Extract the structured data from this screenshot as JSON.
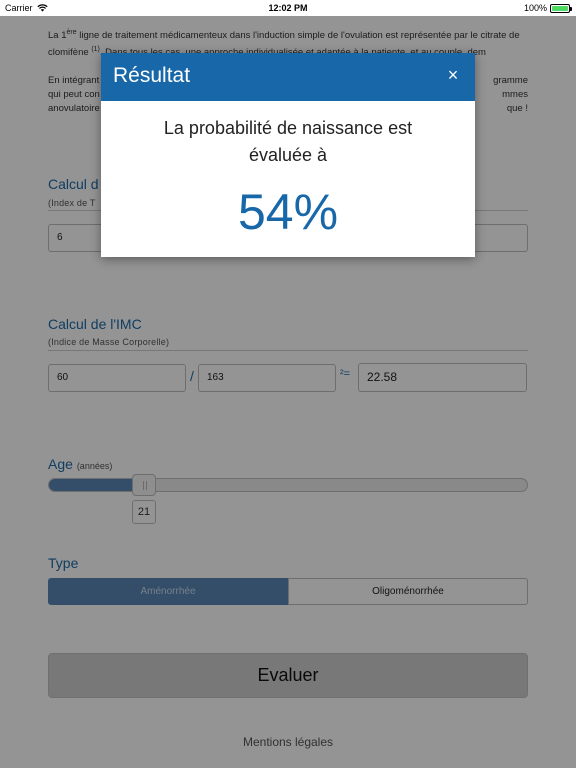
{
  "status_bar": {
    "carrier": "Carrier",
    "time": "12:02 PM",
    "battery": "100%"
  },
  "intro": {
    "p1_before": "La 1",
    "p1_sup": "ère",
    "p1_mid": " ligne de traitement médicamenteux dans l'induction simple de l'ovulation est représentée par le citrate de clomifène ",
    "p1_ref": "(1)",
    "p1_after": ". Dans tous les cas, une approche individualisée et adaptée à la patiente, et au couple, dem",
    "p2_line1_start": "En intégrant",
    "p2_line1_end": "gramme",
    "p2_line2_start": "qui peut con",
    "p2_line2_end": "mmes",
    "p2_line3_start": "anovulatoire",
    "p2_line3_end": "que !"
  },
  "ict": {
    "title": "Calcul d",
    "subtitle": "(Index de T",
    "value": "6"
  },
  "imc": {
    "title": "Calcul de l'IMC",
    "subtitle": "(Indice de Masse Corporelle)",
    "weight": "60",
    "divide": "/",
    "height": "163",
    "equals": "²=",
    "result": "22.58"
  },
  "age": {
    "title": "Age",
    "unit": "(années)",
    "value": "21",
    "slider_fraction": 0.19
  },
  "type": {
    "title": "Type",
    "options": [
      "Aménorrhée",
      "Oligoménorrhée"
    ],
    "selected": "Aménorrhée"
  },
  "evaluate_label": "Evaluer",
  "legal_label": "Mentions légales",
  "modal": {
    "title": "Résultat",
    "close": "×",
    "text_line1": "La probabilité de naissance est",
    "text_line2": "évaluée à",
    "result": "54%"
  },
  "colors": {
    "primary": "#1867a8",
    "slider_fill": "#5b87b6",
    "battery": "#4cd964"
  }
}
